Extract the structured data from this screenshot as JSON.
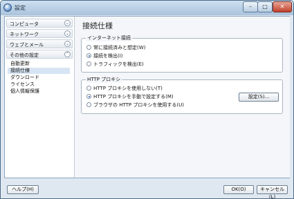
{
  "window": {
    "title": "設定",
    "min": "–",
    "max": "□",
    "close": "✕"
  },
  "sidebar": {
    "categories": [
      {
        "label": "コンピュータ",
        "chevron": "⌄"
      },
      {
        "label": "ネットワーク",
        "chevron": "⌄"
      },
      {
        "label": "ウェブとメール",
        "chevron": "⌄"
      },
      {
        "label": "その他の設定",
        "chevron": "⌃"
      }
    ],
    "items": [
      "自動更新",
      "接続仕様",
      "ダウンロード",
      "ライセンス",
      "個人情報保護"
    ],
    "selected": "接続仕様"
  },
  "main": {
    "title": "接続仕様",
    "internet": {
      "legend": "インターネット接続",
      "options": [
        "常に接続済みと想定(W)",
        "接続を検出(I)",
        "トラフィックを検出(E)"
      ],
      "selected_index": 1
    },
    "proxy": {
      "legend": "HTTP プロキシ",
      "options": [
        "HTTP プロキシを使用しない(T)",
        "HTTP プロキシを手動で設定する(M)",
        "ブラウザの HTTP プロキシを使用する(U)"
      ],
      "selected_index": 1,
      "settings_button": "設定(S)..."
    }
  },
  "footer": {
    "help": "ヘルプ(H)",
    "ok": "OK(O)",
    "cancel": "キャンセル(L)"
  }
}
